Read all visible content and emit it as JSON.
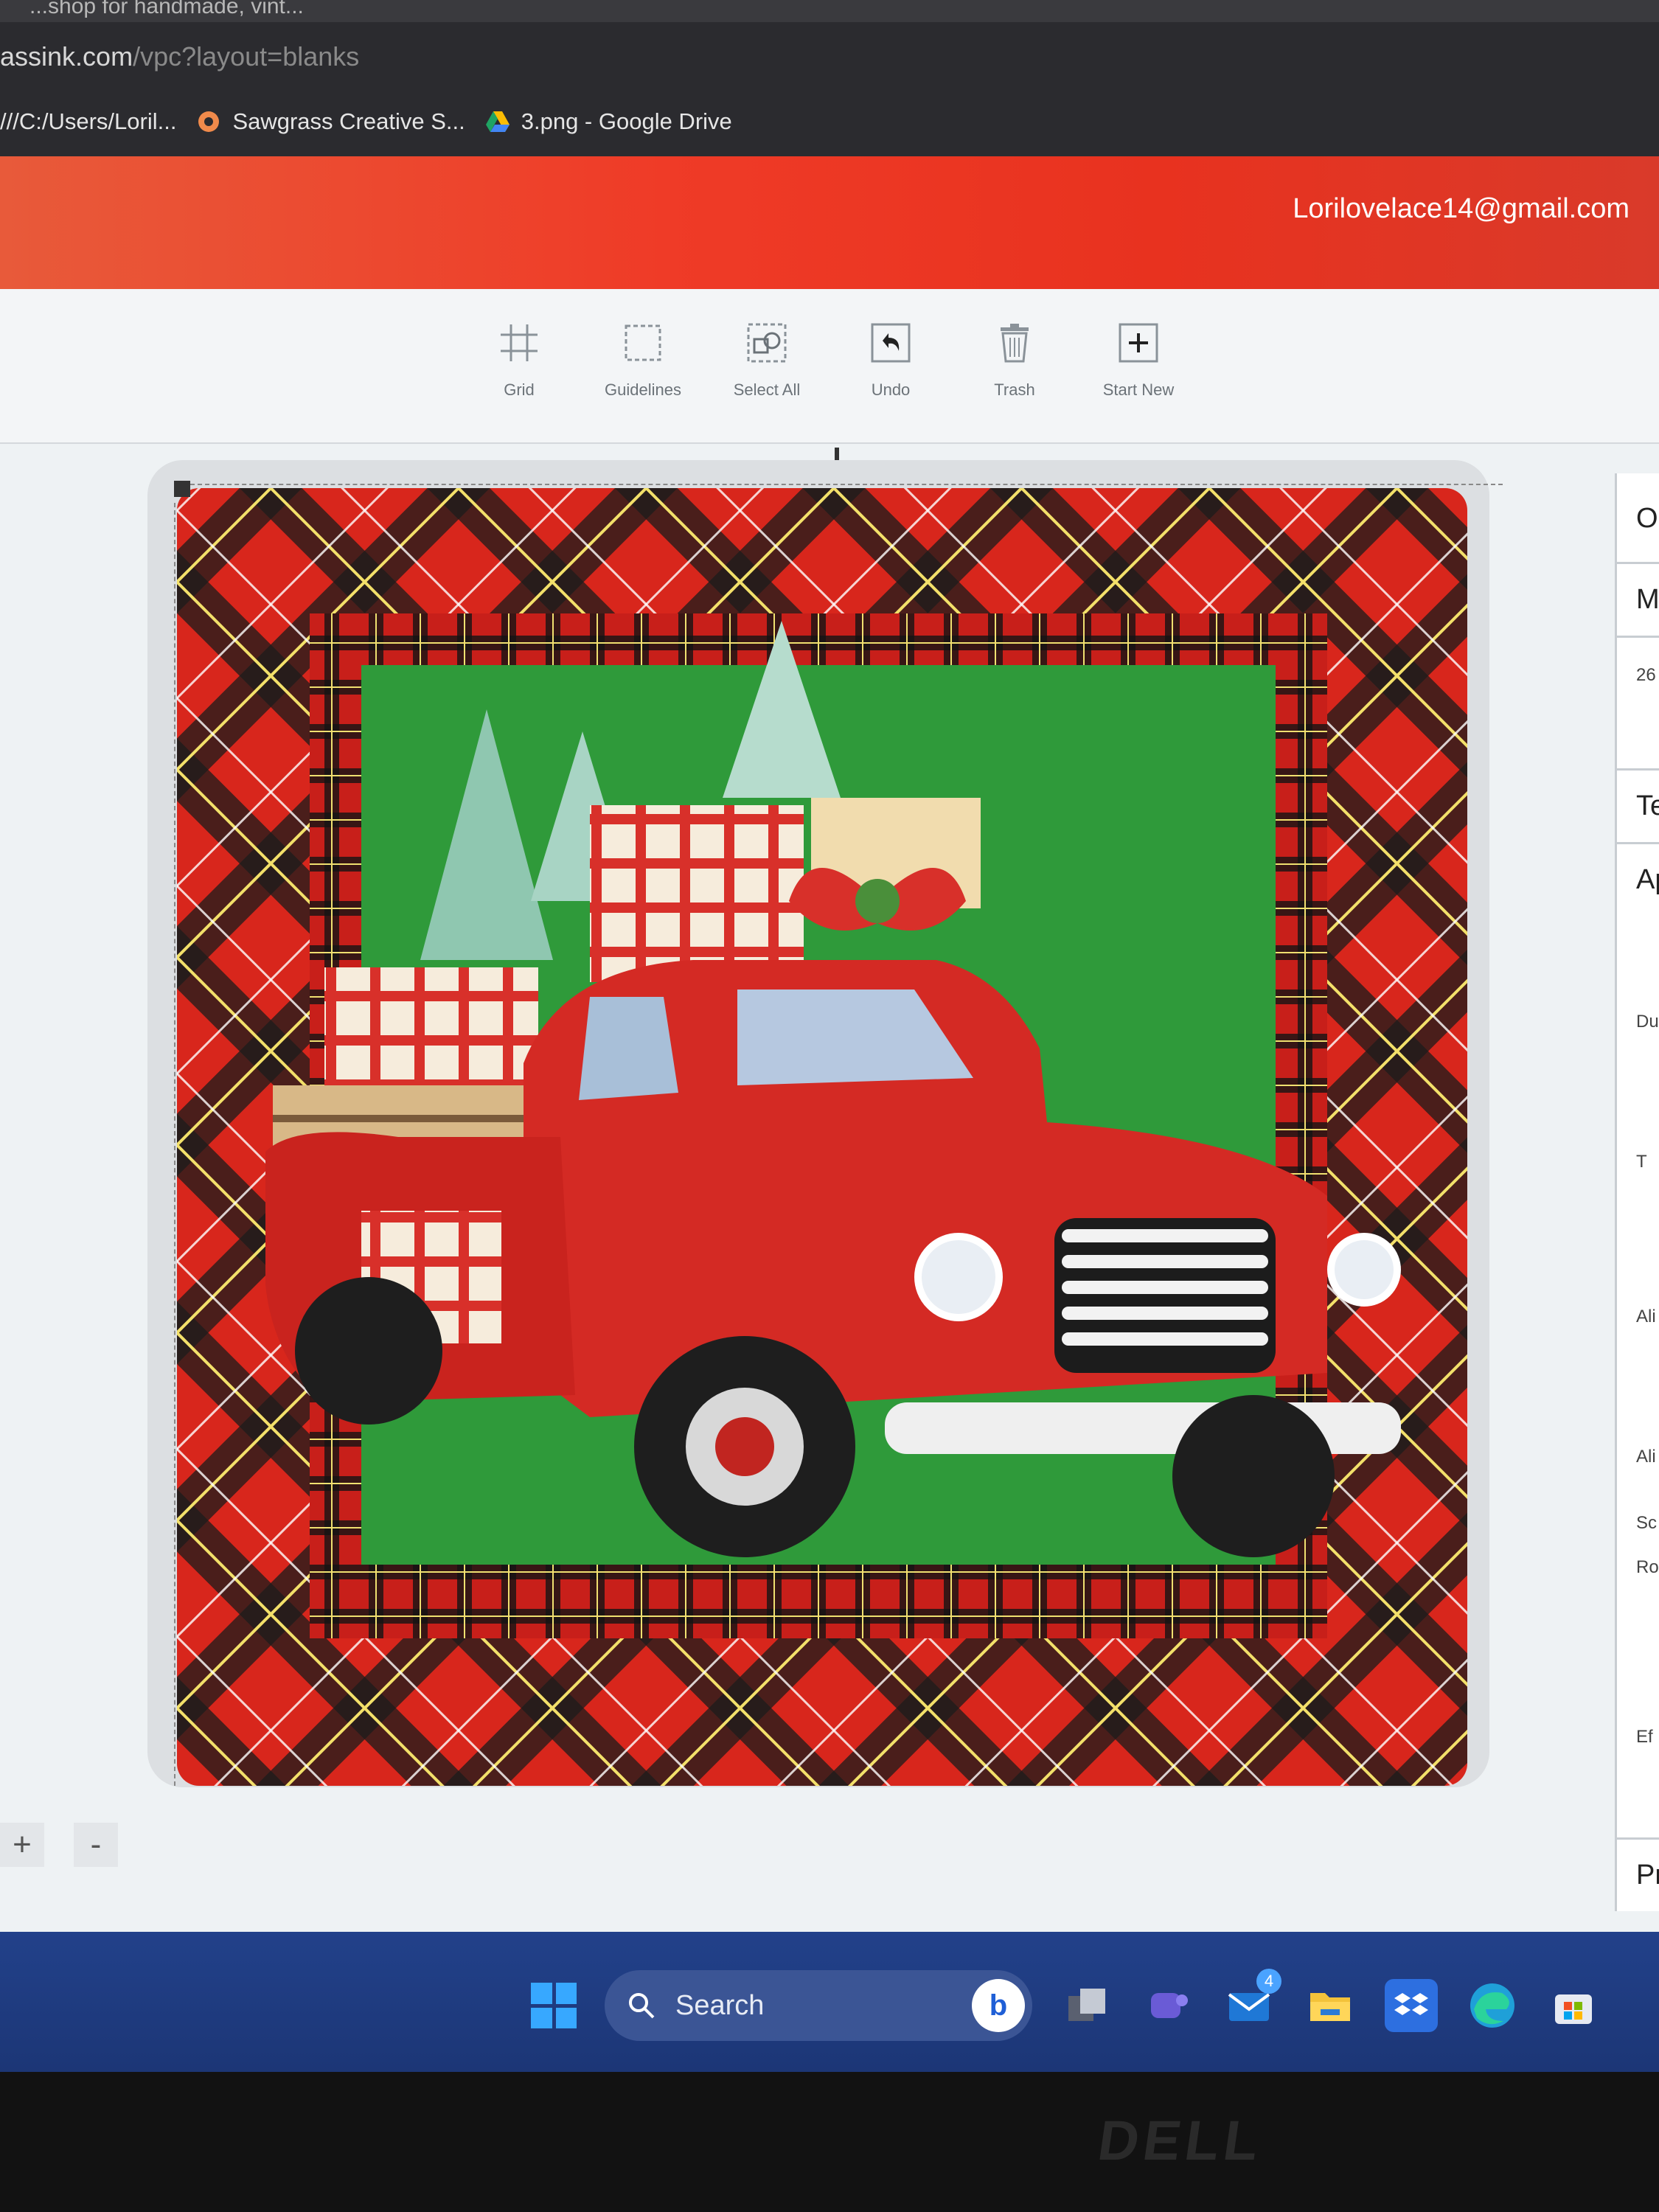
{
  "browser": {
    "tab_text": "...shop for handmade, vint...",
    "address_host": "assink.com",
    "address_path": "/vpc?layout=blanks",
    "bookmarks": [
      {
        "label": "///C:/Users/Loril...",
        "icon": "file-icon"
      },
      {
        "label": "Sawgrass Creative S...",
        "icon": "sawgrass-icon"
      },
      {
        "label": "3.png - Google Drive",
        "icon": "google-drive-icon"
      }
    ]
  },
  "header": {
    "user_email": "Lorilovelace14@gmail.com",
    "colors": {
      "from": "#e85a3a",
      "to": "#e8321f"
    }
  },
  "toolbar": {
    "tools": [
      {
        "label": "Grid",
        "icon": "grid-icon"
      },
      {
        "label": "Guidelines",
        "icon": "guidelines-icon"
      },
      {
        "label": "Select All",
        "icon": "select-all-icon"
      },
      {
        "label": "Undo",
        "icon": "undo-icon"
      },
      {
        "label": "Trash",
        "icon": "trash-icon"
      },
      {
        "label": "Start New",
        "icon": "plus-square-icon"
      }
    ]
  },
  "design": {
    "image": "red-truck-christmas-plaid-design",
    "colors": {
      "plaid_red": "#d8261c",
      "plaid_dark": "#1a1a1a",
      "background_green": "#2f9a3a",
      "truck_red": "#d42a24"
    }
  },
  "right_panel": {
    "items": [
      "O",
      "M",
      "26",
      "Te",
      "Ap",
      "Du",
      "T",
      "Ali",
      "Ali",
      "Sc",
      "Ro",
      "Ef",
      "Pr"
    ]
  },
  "zoom": {
    "plus": "+",
    "minus": "-"
  },
  "taskbar": {
    "search_label": "Search",
    "mail_count": "4",
    "icons": [
      "windows-icon",
      "search-icon",
      "bing-icon",
      "task-view-icon",
      "teams-icon",
      "mail-icon",
      "file-explorer-icon",
      "dropbox-icon",
      "edge-icon",
      "store-icon"
    ]
  },
  "monitor": {
    "brand": "DELL"
  }
}
